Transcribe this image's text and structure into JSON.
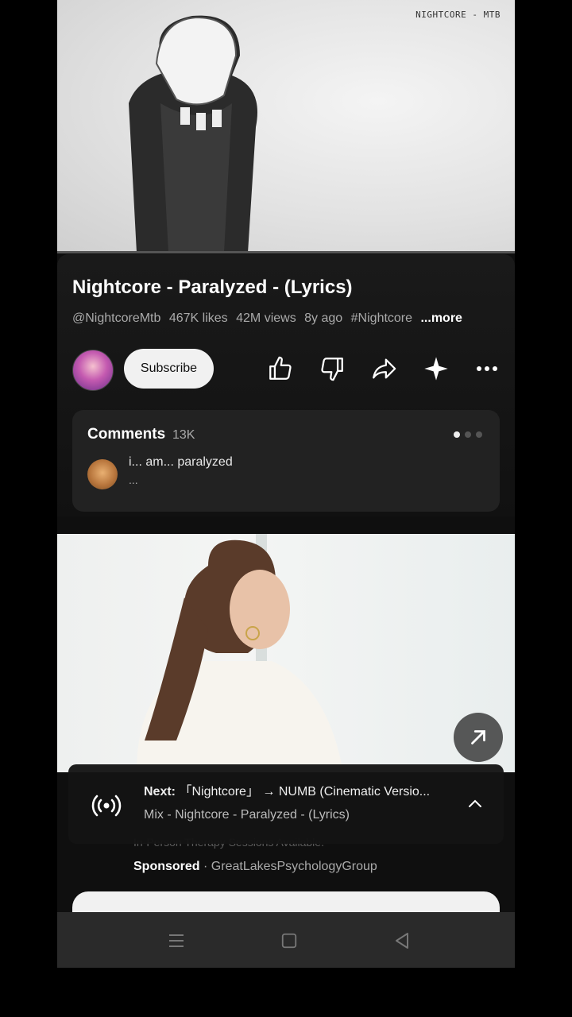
{
  "video": {
    "watermark": "NIGHTCORE - MTB"
  },
  "info": {
    "title": "Nightcore - Paralyzed - (Lyrics)",
    "channel": "@NightcoreMtb",
    "likes": "467K likes",
    "views": "42M views",
    "age": "8y ago",
    "hashtag": "#Nightcore",
    "more": "...more"
  },
  "actions": {
    "subscribe_label": "Subscribe"
  },
  "comments": {
    "heading": "Comments",
    "count": "13K",
    "top_comment": "i... am... paralyzed",
    "ellipsis": "..."
  },
  "ad": {
    "partial_text": "In-Person Therapy Sessions Available.",
    "sponsored_label": "Sponsored",
    "separator": "·",
    "advertiser": "GreatLakesPsychologyGroup"
  },
  "next_up": {
    "prefix": "Next:",
    "track": "「Nightcore」 → NUMB (Cinematic Versio...",
    "mix": "Mix - Nightcore - Paralyzed - (Lyrics)"
  },
  "colors": {
    "background": "#0f0f0f",
    "panel": "#1a1a1a",
    "subscribe_bg": "#f1f1f1",
    "muted_text": "#aaaaaa"
  }
}
